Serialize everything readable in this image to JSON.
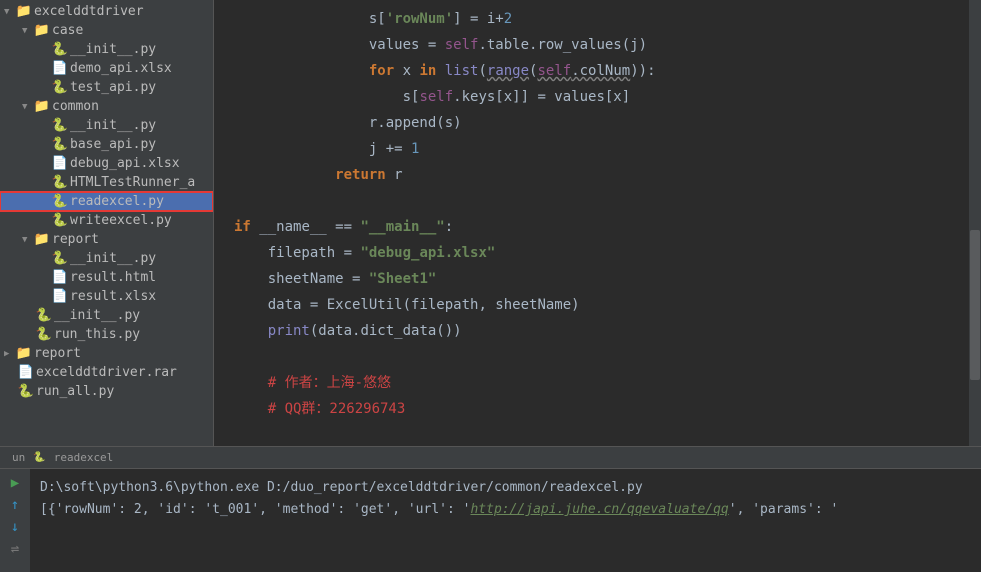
{
  "tree": {
    "root": "excelddtdriver",
    "case": "case",
    "case_init": "__init__.py",
    "case_demo": "demo_api.xlsx",
    "case_test": "test_api.py",
    "common": "common",
    "common_init": "__init__.py",
    "common_base": "base_api.py",
    "common_debug": "debug_api.xlsx",
    "common_html": "HTMLTestRunner_a",
    "common_read": "readexcel.py",
    "common_write": "writeexcel.py",
    "report": "report",
    "report_init": "__init__.py",
    "report_html": "result.html",
    "report_xlsx": "result.xlsx",
    "root_init": "__init__.py",
    "root_run": "run_this.py",
    "report2": "report",
    "rar": "excelddtdriver.rar",
    "runall": "run_all.py"
  },
  "code": {
    "l1_a": "s[",
    "l1_b": "'rowNum'",
    "l1_c": "] = i+",
    "l1_d": "2",
    "l2_a": "values = ",
    "l2_b": "self",
    "l2_c": ".table.row_values(j)",
    "l3_a": "for ",
    "l3_b": "x ",
    "l3_c": "in ",
    "l3_d": "list",
    "l3_e": "(",
    "l3_f": "range",
    "l3_g": "(",
    "l3_h": "self",
    "l3_i": ".colNum",
    "l3_j": ")):",
    "l4_a": "s[",
    "l4_b": "self",
    "l4_c": ".keys[x]] = values[x]",
    "l5_a": "r.append(s)",
    "l6_a": "j += ",
    "l6_b": "1",
    "l7_a": "return ",
    "l7_b": "r",
    "l8_a": "if ",
    "l8_b": "__name__ == ",
    "l8_c": "\"__main__\"",
    "l8_d": ":",
    "l9_a": "filepath = ",
    "l9_b": "\"debug_api.xlsx\"",
    "l10_a": "sheetName = ",
    "l10_b": "\"Sheet1\"",
    "l11_a": "data = ExcelUtil(filepath",
    "l11_b": ", ",
    "l11_c": "sheetName)",
    "l12_a": "print",
    "l12_b": "(data.dict_data())",
    "l13": "# 作者：上海-悠悠",
    "l14": "# QQ群：226296743"
  },
  "console": {
    "tab1": "un",
    "tab2": "readexcel",
    "line1": "D:\\soft\\python3.6\\python.exe D:/duo_report/excelddtdriver/common/readexcel.py",
    "line2_a": "[{'rowNum': 2, 'id': 't_001', 'method': 'get', 'url': '",
    "line2_url": "http://japi.juhe.cn/qqevaluate/qq",
    "line2_b": "', 'params': '"
  },
  "icons": {
    "play": "▶",
    "up": "↑",
    "down": "↓"
  }
}
